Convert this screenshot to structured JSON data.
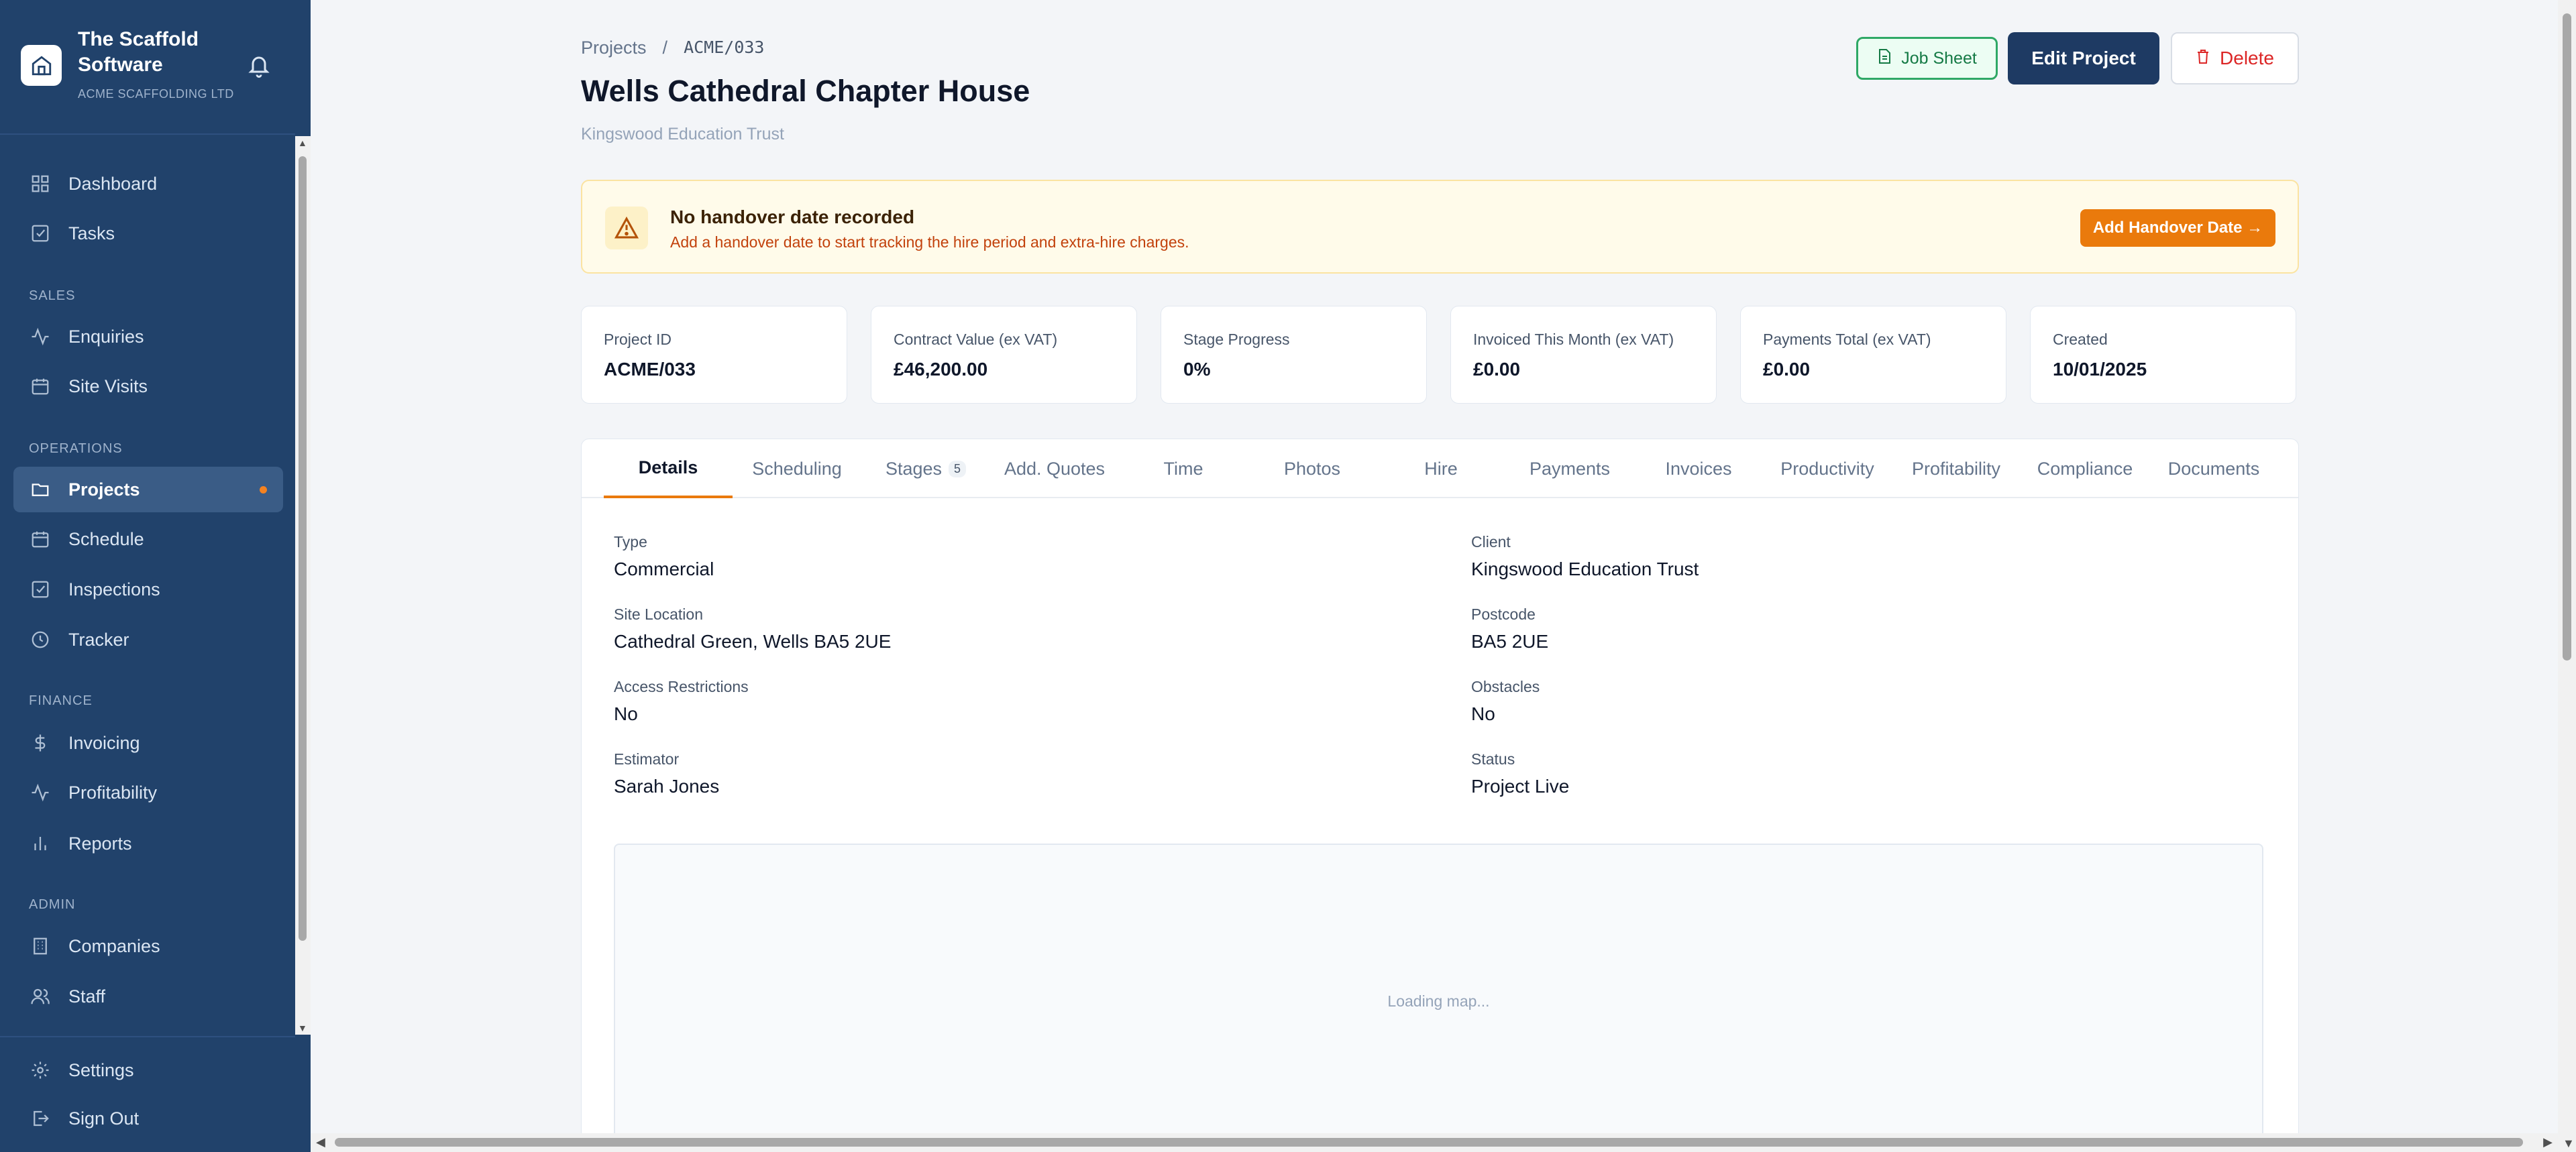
{
  "brand": {
    "title": "The Scaffold Software",
    "company": "ACME SCAFFOLDING LTD"
  },
  "nav": {
    "dashboard": "Dashboard",
    "tasks": "Tasks",
    "section_sales": "SALES",
    "enquiries": "Enquiries",
    "site_visits": "Site Visits",
    "section_operations": "OPERATIONS",
    "projects": "Projects",
    "schedule": "Schedule",
    "inspections": "Inspections",
    "tracker": "Tracker",
    "section_finance": "FINANCE",
    "invoicing": "Invoicing",
    "profitability": "Profitability",
    "reports": "Reports",
    "section_admin": "ADMIN",
    "companies": "Companies",
    "staff": "Staff",
    "settings": "Settings",
    "sign_out": "Sign Out"
  },
  "breadcrumb": {
    "root": "Projects",
    "separator": "/",
    "current": "ACME/033"
  },
  "page": {
    "title": "Wells Cathedral Chapter House",
    "subtitle": "Kingswood Education Trust"
  },
  "actions": {
    "job_sheet": "Job Sheet",
    "edit": "Edit Project",
    "delete": "Delete"
  },
  "alert": {
    "title": "No handover date recorded",
    "text": "Add a handover date to start tracking the hire period and extra-hire charges.",
    "button": "Add Handover Date →"
  },
  "stats": [
    {
      "label": "Project ID",
      "value": "ACME/033"
    },
    {
      "label": "Contract Value (ex VAT)",
      "value": "£46,200.00"
    },
    {
      "label": "Stage Progress",
      "value": "0%"
    },
    {
      "label": "Invoiced This Month (ex VAT)",
      "value": "£0.00"
    },
    {
      "label": "Payments Total (ex VAT)",
      "value": "£0.00"
    },
    {
      "label": "Created",
      "value": "10/01/2025"
    }
  ],
  "tabs": {
    "details": "Details",
    "scheduling": "Scheduling",
    "stages": "Stages",
    "stages_count": "5",
    "add_quotes": "Add. Quotes",
    "time": "Time",
    "photos": "Photos",
    "hire": "Hire",
    "payments": "Payments",
    "invoices": "Invoices",
    "productivity": "Productivity",
    "profitability": "Profitability",
    "compliance": "Compliance",
    "documents": "Documents"
  },
  "details": {
    "type_label": "Type",
    "type_value": "Commercial",
    "client_label": "Client",
    "client_value": "Kingswood Education Trust",
    "site_label": "Site Location",
    "site_value": "Cathedral Green, Wells BA5 2UE",
    "postcode_label": "Postcode",
    "postcode_value": "BA5 2UE",
    "access_label": "Access Restrictions",
    "access_value": "No",
    "obstacles_label": "Obstacles",
    "obstacles_value": "No",
    "estimator_label": "Estimator",
    "estimator_value": "Sarah Jones",
    "status_label": "Status",
    "status_value": "Project Live"
  },
  "map": {
    "loading": "Loading map..."
  },
  "colors": {
    "sidebar": "#21426b",
    "accent": "#ea7a0c",
    "primary_button": "#1e3a63",
    "danger": "#dc2626",
    "success": "#2fa866"
  },
  "icons": [
    "home-icon",
    "bell-icon",
    "grid-icon",
    "check-square-icon",
    "activity-icon",
    "calendar-icon",
    "folder-icon",
    "clock-icon",
    "dollar-icon",
    "bar-chart-icon",
    "building-icon",
    "users-icon",
    "gear-icon",
    "logout-icon",
    "file-icon",
    "trash-icon",
    "warning-icon"
  ]
}
